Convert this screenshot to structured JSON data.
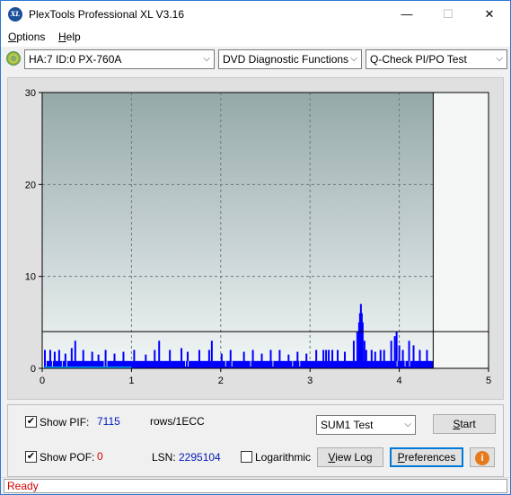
{
  "window": {
    "title": "PlexTools Professional XL V3.16",
    "icon_label": "XL",
    "controls": {
      "minimize": "—",
      "maximize": "☐",
      "close": "✕"
    }
  },
  "menu": {
    "options": {
      "mnemonic": "O",
      "rest": "ptions"
    },
    "help": {
      "mnemonic": "H",
      "rest": "elp"
    }
  },
  "toolbar": {
    "drive_combo": "HA:7 ID:0  PX-760A",
    "function_combo": "DVD Diagnostic Functions",
    "test_combo": "Q-Check PI/PO Test",
    "arrow": "⌵"
  },
  "chart_data": {
    "type": "bar",
    "xlim": [
      0,
      5
    ],
    "ylim": [
      0,
      30
    ],
    "xticks": [
      "0",
      "1",
      "2",
      "3",
      "4",
      "5"
    ],
    "yticks": [
      "0",
      "10",
      "20",
      "30"
    ],
    "grid": true,
    "threshold_line": 4,
    "scan_end_x": 4.38,
    "colors": {
      "pif": "#0000ff",
      "pof": "#00a0ff",
      "plot_top": "#95a9a9",
      "plot_bottom": "#f2f6f6",
      "grid": "#6e7a7a"
    },
    "pif_baseline": {
      "x_start": 0.02,
      "x_end": 4.38,
      "value": 0.8
    },
    "pif_spikes": [
      [
        0.02,
        2
      ],
      [
        0.08,
        2
      ],
      [
        0.13,
        1.8
      ],
      [
        0.18,
        2
      ],
      [
        0.25,
        1.6
      ],
      [
        0.32,
        2.2
      ],
      [
        0.36,
        3
      ],
      [
        0.45,
        2
      ],
      [
        0.55,
        1.8
      ],
      [
        0.62,
        1.5
      ],
      [
        0.7,
        2
      ],
      [
        0.8,
        1.6
      ],
      [
        0.9,
        1.8
      ],
      [
        1.02,
        2
      ],
      [
        1.15,
        1.5
      ],
      [
        1.25,
        2
      ],
      [
        1.3,
        3
      ],
      [
        1.42,
        2
      ],
      [
        1.55,
        2.2
      ],
      [
        1.62,
        1.8
      ],
      [
        1.75,
        2
      ],
      [
        1.86,
        2
      ],
      [
        1.89,
        3
      ],
      [
        2.0,
        1.6
      ],
      [
        2.1,
        2
      ],
      [
        2.25,
        1.8
      ],
      [
        2.35,
        2
      ],
      [
        2.45,
        1.6
      ],
      [
        2.55,
        2
      ],
      [
        2.65,
        2
      ],
      [
        2.75,
        1.5
      ],
      [
        2.85,
        1.8
      ],
      [
        2.95,
        1.6
      ],
      [
        3.06,
        2
      ],
      [
        3.14,
        2
      ],
      [
        3.17,
        2
      ],
      [
        3.2,
        2
      ],
      [
        3.24,
        2
      ],
      [
        3.3,
        2
      ],
      [
        3.38,
        1.8
      ],
      [
        3.48,
        3
      ],
      [
        3.52,
        4
      ],
      [
        3.54,
        5
      ],
      [
        3.55,
        6
      ],
      [
        3.56,
        7
      ],
      [
        3.57,
        6
      ],
      [
        3.58,
        5
      ],
      [
        3.6,
        3
      ],
      [
        3.62,
        2
      ],
      [
        3.68,
        2
      ],
      [
        3.72,
        1.8
      ],
      [
        3.78,
        2
      ],
      [
        3.82,
        2
      ],
      [
        3.9,
        3
      ],
      [
        3.94,
        3.5
      ],
      [
        3.96,
        4
      ],
      [
        3.99,
        2.5
      ],
      [
        4.03,
        2
      ],
      [
        4.1,
        3
      ],
      [
        4.15,
        2.5
      ],
      [
        4.22,
        2
      ],
      [
        4.3,
        2
      ]
    ],
    "pif_gaps": [
      0.04,
      0.11,
      0.22,
      0.27,
      0.69,
      0.72,
      1.6,
      1.63,
      2.05,
      2.12,
      2.33,
      2.58,
      2.8,
      2.88,
      3.97,
      4.06,
      4.11
    ]
  },
  "controls": {
    "show_pif_label": "Show PIF:",
    "pif_value": "7115",
    "rows_label": "rows/1ECC",
    "show_pof_label": "Show POF:",
    "pof_value": "0",
    "lsn_label": "LSN:",
    "lsn_value": "2295104",
    "logarithmic_label": "Logarithmic",
    "sum_select": "SUM1 Test",
    "start_button": {
      "mnemonic": "S",
      "rest": "tart"
    },
    "view_log_button": {
      "mnemonic": "V",
      "rest": "iew Log"
    },
    "preferences_button": {
      "mnemonic": "P",
      "rest": "references"
    },
    "check": "✔",
    "info_icon_glyph": "i"
  },
  "status": {
    "text": "Ready"
  }
}
